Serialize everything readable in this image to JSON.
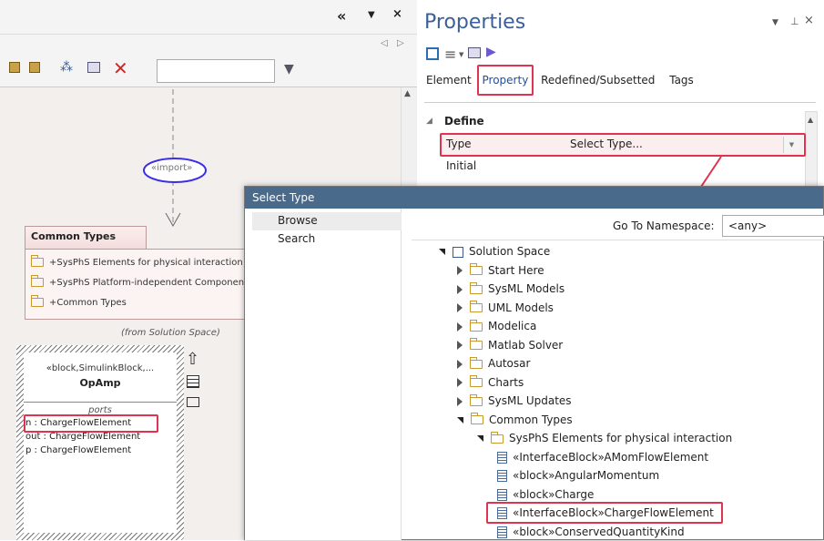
{
  "diagram": {
    "import_label": "«import»",
    "package": {
      "title": "Common Types",
      "items": [
        "+SysPhS Elements for physical interaction",
        "+SysPhS Platform-independent Components",
        "+Common Types"
      ],
      "from": "(from Solution Space)"
    },
    "block": {
      "stereotype": "«block,SimulinkBlock,...",
      "name": "OpAmp",
      "compartment": "ports",
      "ports": [
        "n : ChargeFlowElement",
        "out : ChargeFlowElement",
        "p : ChargeFlowElement"
      ]
    }
  },
  "props": {
    "title": "Properties",
    "tabs": [
      "Element",
      "Property",
      "Redefined/Subsetted",
      "Tags"
    ],
    "active_tab": "Property",
    "section": "Define",
    "rows": [
      {
        "name": "Type",
        "value": "Select Type..."
      },
      {
        "name": "Initial",
        "value": ""
      }
    ]
  },
  "dialog": {
    "title": "Select Type",
    "nav": [
      "Browse",
      "Search"
    ],
    "namespace_label": "Go To Namespace:",
    "namespace_value": "<any>",
    "tree": [
      {
        "label": "Solution Space",
        "state": "open",
        "level": 0,
        "icon": "model"
      },
      {
        "label": "Start Here",
        "state": "closed",
        "level": 1,
        "icon": "folder"
      },
      {
        "label": "SysML Models",
        "state": "closed",
        "level": 1,
        "icon": "folder"
      },
      {
        "label": "UML Models",
        "state": "closed",
        "level": 1,
        "icon": "folder"
      },
      {
        "label": "Modelica",
        "state": "closed",
        "level": 1,
        "icon": "folder"
      },
      {
        "label": "Matlab Solver",
        "state": "closed",
        "level": 1,
        "icon": "folder"
      },
      {
        "label": "Autosar",
        "state": "closed",
        "level": 1,
        "icon": "folder"
      },
      {
        "label": "Charts",
        "state": "closed",
        "level": 1,
        "icon": "folder"
      },
      {
        "label": "SysML Updates",
        "state": "closed",
        "level": 1,
        "icon": "folder"
      },
      {
        "label": "Common Types",
        "state": "open",
        "level": 1,
        "icon": "folder"
      },
      {
        "label": "SysPhS Elements for physical interaction",
        "state": "open",
        "level": 2,
        "icon": "folder"
      },
      {
        "label": "«InterfaceBlock»AMomFlowElement",
        "state": "leaf",
        "level": 3,
        "icon": "element"
      },
      {
        "label": "«block»AngularMomentum",
        "state": "leaf",
        "level": 3,
        "icon": "element"
      },
      {
        "label": "«block»Charge",
        "state": "leaf",
        "level": 3,
        "icon": "element"
      },
      {
        "label": "«InterfaceBlock»ChargeFlowElement",
        "state": "leaf",
        "level": 3,
        "icon": "element",
        "selected": true
      },
      {
        "label": "«block»ConservedQuantityKind",
        "state": "leaf",
        "level": 3,
        "icon": "element"
      }
    ]
  },
  "colors": {
    "highlight": "#e0334f",
    "dialog_title": "#4a6a8c",
    "import_ellipse": "#3a2ee6"
  }
}
